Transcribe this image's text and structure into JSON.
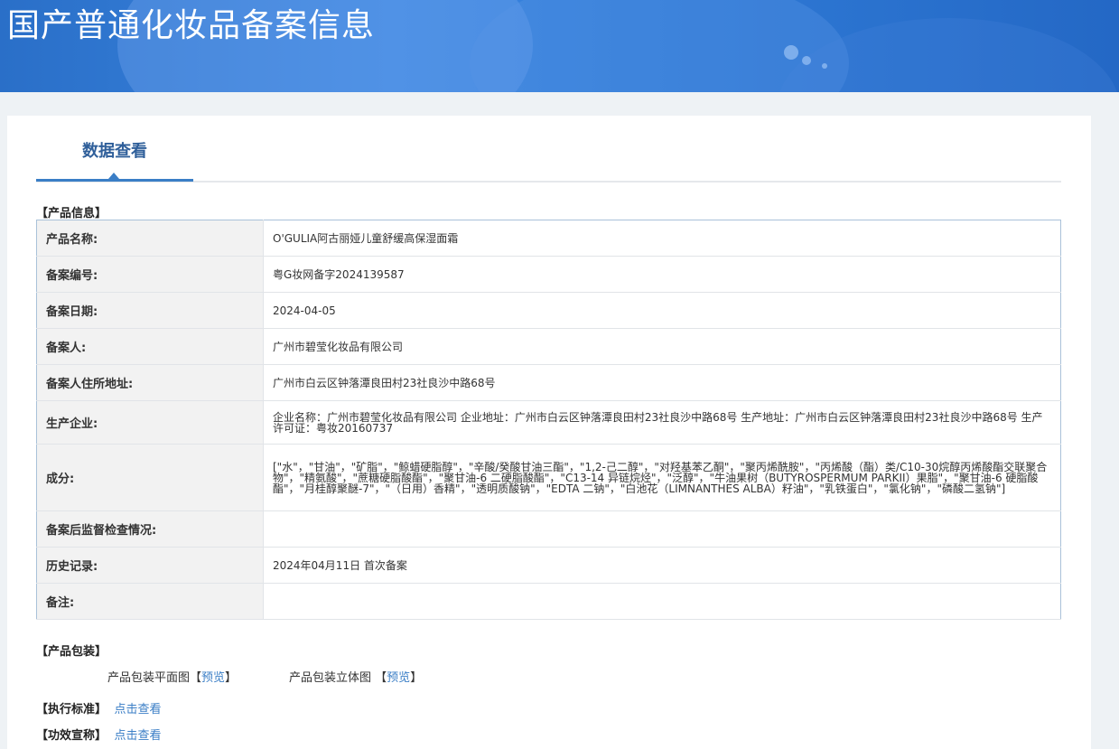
{
  "page_title": "国产普通化妆品备案信息",
  "tab": "数据查看",
  "sections": {
    "product_info": "【产品信息】",
    "packaging": "【产品包装】",
    "standard": "【执行标准】",
    "efficacy": "【功效宣称】"
  },
  "rows": [
    {
      "label": "产品名称:",
      "value": "O'GULIA阿古丽娅儿童舒缓高保湿面霜"
    },
    {
      "label": "备案编号:",
      "value": "粤G妆网备字2024139587"
    },
    {
      "label": "备案日期:",
      "value": "2024-04-05"
    },
    {
      "label": "备案人:",
      "value": "广州市碧莹化妆品有限公司"
    },
    {
      "label": "备案人住所地址:",
      "value": "广州市白云区钟落潭良田村23社良沙中路68号"
    },
    {
      "label": "生产企业:",
      "value": "企业名称：广州市碧莹化妆品有限公司 企业地址：广州市白云区钟落潭良田村23社良沙中路68号 生产地址：广州市白云区钟落潭良田村23社良沙中路68号 生产许可证：粤妆20160737"
    },
    {
      "label": "成分:",
      "value": "[\"水\"，\"甘油\"，\"矿脂\"，\"鲸蜡硬脂醇\"，\"辛酸/癸酸甘油三酯\"，\"1,2-己二醇\"，\"对羟基苯乙酮\"，\"聚丙烯酰胺\"，\"丙烯酸（酯）类/C10-30烷醇丙烯酸酯交联聚合物\"，\"精氨酸\"，\"蔗糖硬脂酸酯\"，\"聚甘油-6 二硬脂酸酯\"，\"C13-14 异链烷烃\"，\"泛醇\"，\"牛油果树（BUTYROSPERMUM PARKII）果脂\"，\"聚甘油-6 硬脂酸酯\"，\"月桂醇聚醚-7\"，\"（日用）香精\"，\"透明质酸钠\"，\"EDTA 二钠\"，\"白池花（LIMNANTHES ALBA）籽油\"，\"乳铁蛋白\"，\"氯化钠\"，\"磷酸二氢钠\"]"
    },
    {
      "label": "备案后监督检查情况:",
      "value": ""
    },
    {
      "label": "历史记录:",
      "value": "2024年04月11日 首次备案"
    },
    {
      "label": "备注:",
      "value": ""
    }
  ],
  "packaging": {
    "flat_label": "产品包装平面图",
    "flat_link": "预览",
    "solid_label": "产品包装立体图",
    "solid_link": "预览",
    "bracket_open": "【",
    "bracket_close": "】"
  },
  "standard_link": "点击查看",
  "efficacy_link": "点击查看"
}
